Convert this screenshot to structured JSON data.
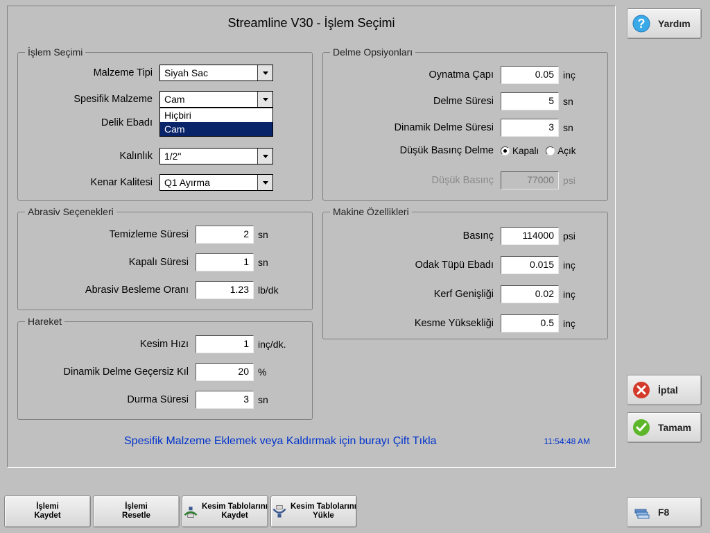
{
  "header": {
    "title": "Streamline V30 - İşlem Seçimi"
  },
  "side": {
    "help_label": "Yardım",
    "cancel_label": "İptal",
    "ok_label": "Tamam",
    "f8_label": "F8"
  },
  "process": {
    "legend": "İşlem Seçimi",
    "material_type_label": "Malzeme Tipi",
    "material_type_value": "Siyah Sac",
    "specific_material_label": "Spesifik Malzeme",
    "specific_material_value": "Cam",
    "specific_material_options": [
      "Hiçbiri",
      "Cam"
    ],
    "hole_size_label": "Delik Ebadı",
    "thickness_label": "Kalınlık",
    "thickness_value": "1/2\"",
    "edge_quality_label": "Kenar Kalitesi",
    "edge_quality_value": "Q1 Ayırma"
  },
  "abrasive": {
    "legend": "Abrasiv Seçenekleri",
    "cleaning_time_label": "Temizleme Süresi",
    "cleaning_time_value": "2",
    "cleaning_time_unit": "sn",
    "off_time_label": "Kapalı Süresi",
    "off_time_value": "1",
    "off_time_unit": "sn",
    "feed_rate_label": "Abrasiv Besleme Oranı",
    "feed_rate_value": "1.23",
    "feed_rate_unit": "lb/dk"
  },
  "motion": {
    "legend": "Hareket",
    "cut_speed_label": "Kesim Hızı",
    "cut_speed_value": "1",
    "cut_speed_unit": "inç/dk.",
    "ddo_label": "Dinamik Delme Geçersiz Kıl",
    "ddo_value": "20",
    "ddo_unit": "%",
    "dwell_label": "Durma Süresi",
    "dwell_value": "3",
    "dwell_unit": "sn"
  },
  "pierce": {
    "legend": "Delme Opsiyonları",
    "play_dia_label": "Oynatma Çapı",
    "play_dia_value": "0.05",
    "play_dia_unit": "inç",
    "pierce_time_label": "Delme Süresi",
    "pierce_time_value": "5",
    "pierce_time_unit": "sn",
    "dyn_pierce_time_label": "Dinamik Delme Süresi",
    "dyn_pierce_time_value": "3",
    "dyn_pierce_time_unit": "sn",
    "low_pressure_pierce_label": "Düşük Basınç Delme",
    "low_pressure_off_label": "Kapalı",
    "low_pressure_on_label": "Açık",
    "low_pressure_label": "Düşük Basınç",
    "low_pressure_value": "77000",
    "low_pressure_unit": "psi"
  },
  "machine": {
    "legend": "Makine Özellikleri",
    "pressure_label": "Basınç",
    "pressure_value": "114000",
    "pressure_unit": "psi",
    "focus_tube_label": "Odak Tüpü Ebadı",
    "focus_tube_value": "0.015",
    "focus_tube_unit": "inç",
    "kerf_label": "Kerf Genişliği",
    "kerf_value": "0.02",
    "kerf_unit": "inç",
    "cut_height_label": "Kesme Yüksekliği",
    "cut_height_value": "0.5",
    "cut_height_unit": "inç"
  },
  "footer": {
    "hint": "Spesifik Malzeme Eklemek veya Kaldırmak için burayı Çift Tıkla",
    "timestamp": "11:54:48 AM"
  },
  "toolbar": {
    "save_process": "İşlemi\nKaydet",
    "reset_process": "İşlemi\nResetle",
    "save_cut_tables": "Kesim Tablolarını\nKaydet",
    "load_cut_tables": "Kesim Tablolarını\nYükle"
  }
}
